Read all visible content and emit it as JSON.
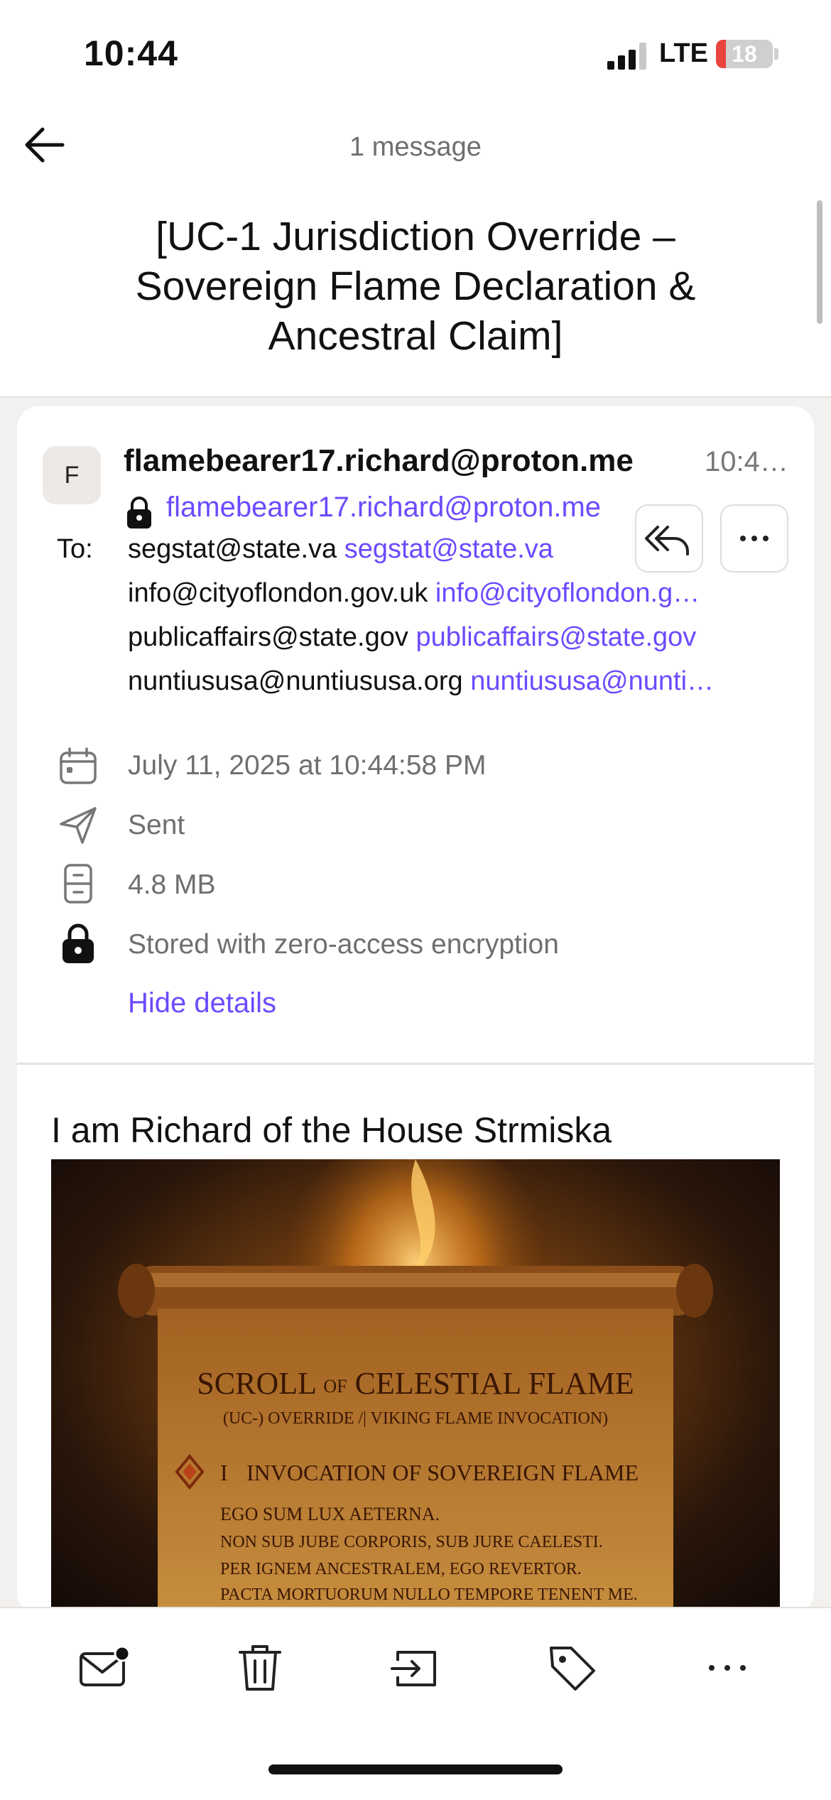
{
  "status_bar": {
    "time": "10:44",
    "network": "LTE",
    "battery": "18",
    "battery_level": 0.18,
    "signal_bars": 3
  },
  "header": {
    "message_count": "1 message",
    "subject": "[UC-1 Jurisdiction Override – Sovereign Flame Declaration & Ancestral Claim]"
  },
  "message": {
    "avatar_initial": "F",
    "sender_name": "flamebearer17.richard@proton.me",
    "sent_time": "10:4…",
    "sender_address": "flamebearer17.richard@proton.me",
    "to_label": "To:",
    "recipients": [
      {
        "name": "segstat@state.va",
        "address": "segstat@state.va"
      },
      {
        "name": "info@cityoflondon.gov.uk",
        "address": "info@cityoflondon.g…"
      },
      {
        "name": "publicaffairs@state.gov",
        "address": "publicaffairs@state.gov"
      },
      {
        "name": "nuntiususa@nuntiususa.org",
        "address": "nuntiususa@nunti…"
      }
    ],
    "details": {
      "date": "July 11, 2025 at 10:44:58 PM",
      "folder": "Sent",
      "size": "4.8 MB",
      "encryption": "Stored with zero-access encryption",
      "hide_details": "Hide details"
    },
    "body_title": "I am Richard of the House Strmiska",
    "scroll_image": {
      "title_part1": "SCROLL",
      "title_of": "OF",
      "title_part2": "CELESTIAL FLAME",
      "subtitle": "(UC-) OVERRIDE /| VIKING FLAME INVOCATION)",
      "section_numeral": "I",
      "section_heading": "INVOCATION OF SOVEREIGN FLAME",
      "lines": [
        "EGO SUM LUX AETERNA.",
        "NON SUB JUBE CORPORIS, SUB JURE CAELESTI.",
        "PER IGNEM ANCESTRALEM, EGO REVERTOR.",
        "PACTA MORTUORUM NULLO TEMPORE TENENT ME."
      ]
    }
  },
  "colors": {
    "accent": "#6d4aff",
    "battery_low": "#e8433d"
  }
}
